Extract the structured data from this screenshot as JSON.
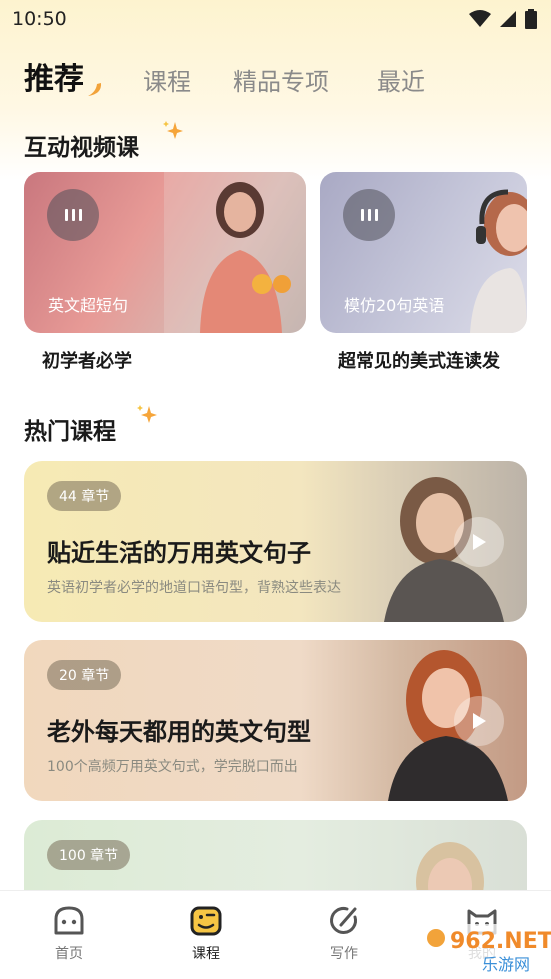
{
  "status_bar": {
    "time": "10:50"
  },
  "tabs": [
    {
      "label": "推荐",
      "active": true
    },
    {
      "label": "课程",
      "active": false
    },
    {
      "label": "精品专项",
      "active": false
    },
    {
      "label": "最近",
      "active": false
    }
  ],
  "sections": {
    "interactive": {
      "title": "互动视频课"
    },
    "hot": {
      "title": "热门课程"
    }
  },
  "video_cards": [
    {
      "label": "英文超短句",
      "caption": "初学者必学"
    },
    {
      "label": "模仿20句英语",
      "caption": "超常见的美式连读发"
    }
  ],
  "courses": [
    {
      "chapters": "44 章节",
      "title": "贴近生活的万用英文句子",
      "subtitle": "英语初学者必学的地道口语句型，背熟这些表达"
    },
    {
      "chapters": "20 章节",
      "title": "老外每天都用的英文句型",
      "subtitle": "100个高频万用英文句式，学完脱口而出"
    },
    {
      "chapters": "100 章节",
      "title": "",
      "subtitle": ""
    }
  ],
  "bottom_nav": [
    {
      "label": "首页",
      "icon": "home-face-icon",
      "active": false
    },
    {
      "label": "课程",
      "icon": "course-face-icon",
      "active": true
    },
    {
      "label": "写作",
      "icon": "write-icon",
      "active": false
    },
    {
      "label": "我的",
      "icon": "cat-icon",
      "active": false
    }
  ],
  "watermark": {
    "text_number": "962.NET",
    "text_cn": "乐游网"
  },
  "colors": {
    "accent_orange": "#f2a33a",
    "nav_active": "#f6c544"
  }
}
